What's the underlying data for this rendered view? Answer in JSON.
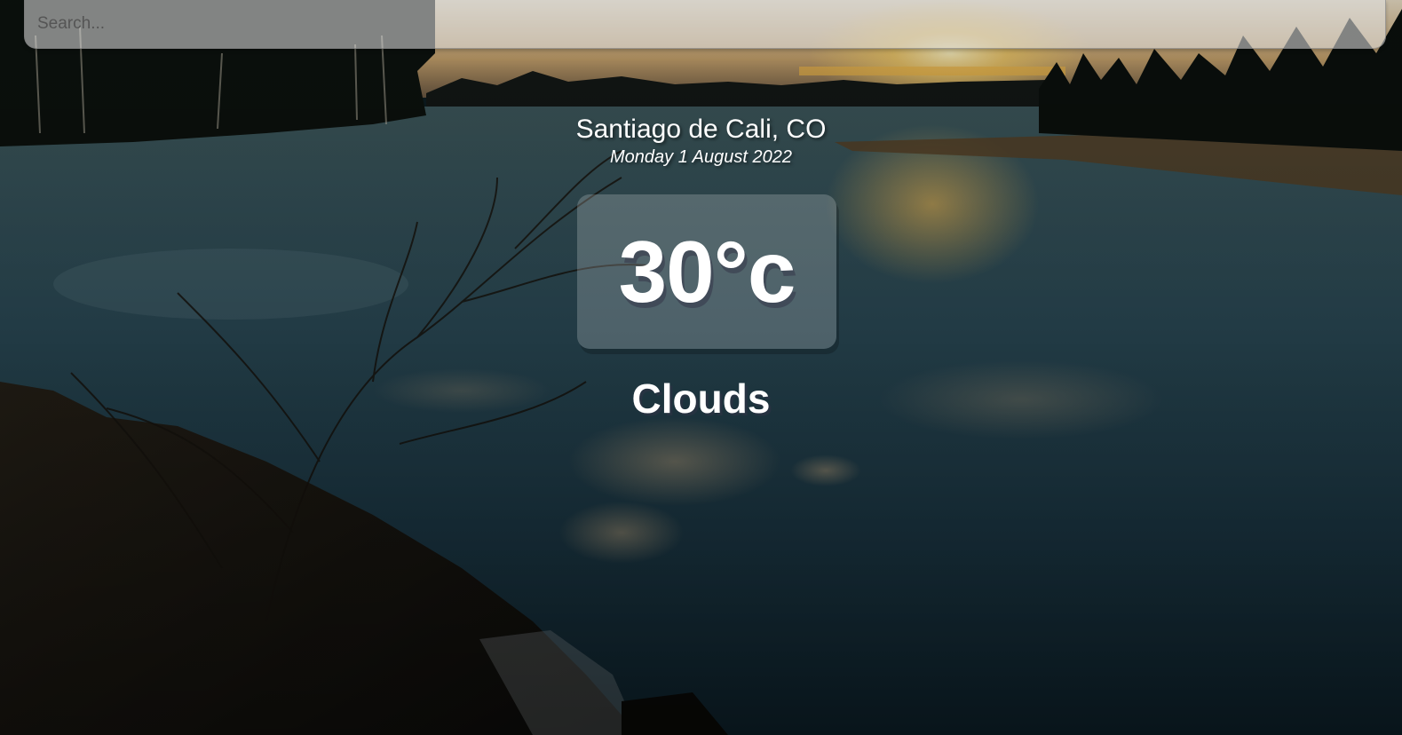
{
  "search": {
    "placeholder": "Search..."
  },
  "location": {
    "city": "Santiago de Cali, CO",
    "date": "Monday 1 August 2022"
  },
  "weather": {
    "temperature": "30°c",
    "condition": "Clouds"
  },
  "background": {
    "scene": "lake-sunset-landscape",
    "colors": {
      "sky": "#c9b79a",
      "sun": "#f5d27a",
      "water": "#2a4650",
      "forest": "#141a16",
      "shore": "#2a2016"
    }
  }
}
